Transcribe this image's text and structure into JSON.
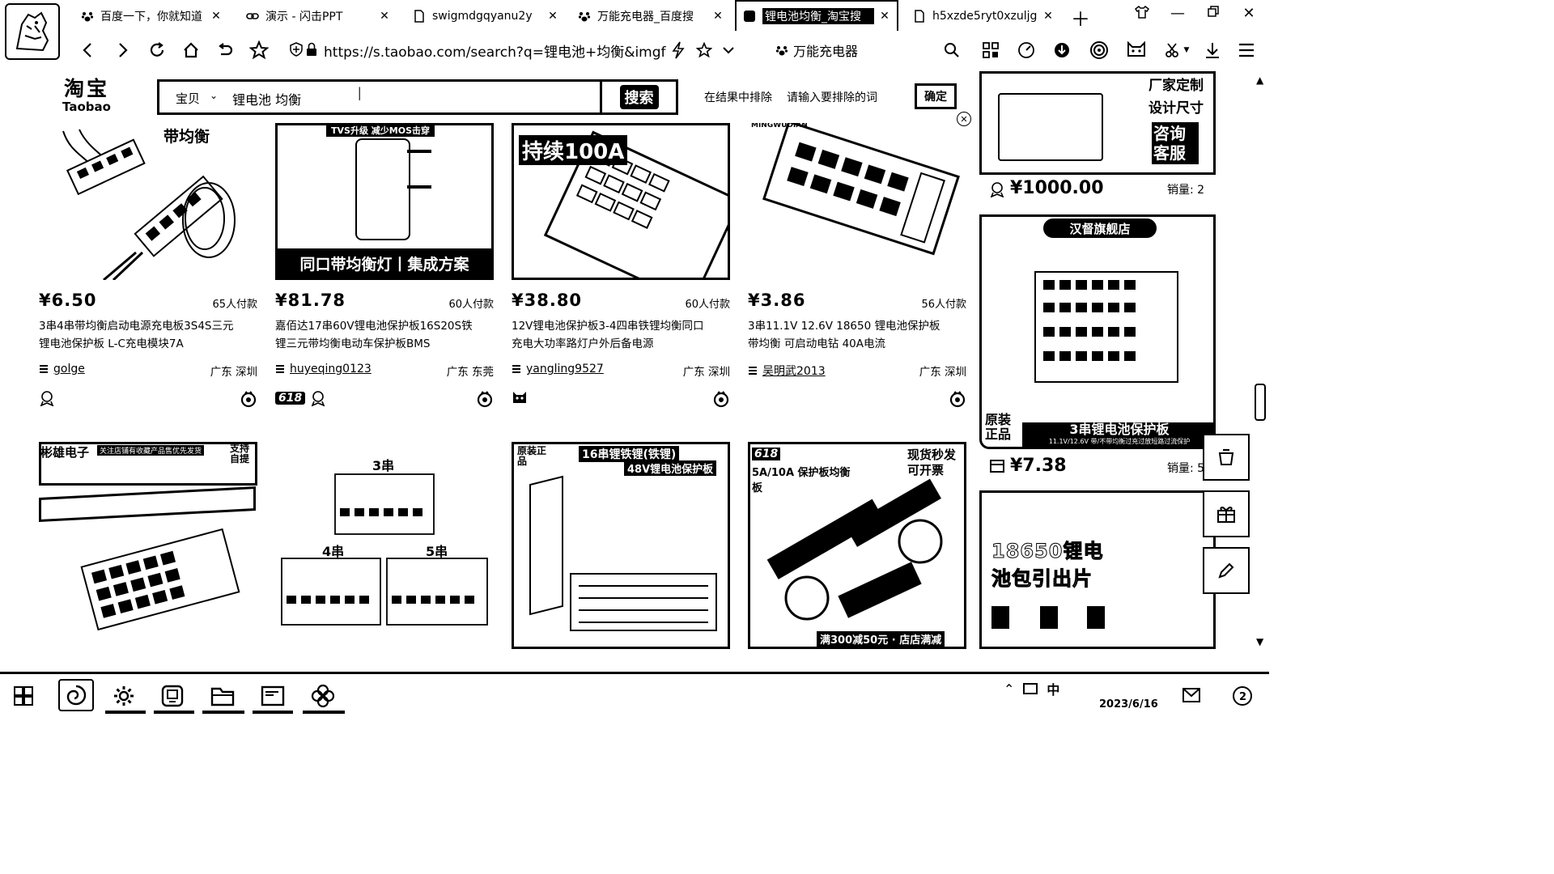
{
  "browser": {
    "tabs": [
      {
        "label": "百度一下，你就知道",
        "icon": "paw-icon"
      },
      {
        "label": "演示 - 闪击PPT",
        "icon": "link-icon"
      },
      {
        "label": "swigmdgqyanu2y",
        "icon": "doc-icon"
      },
      {
        "label": "万能充电器_百度搜",
        "icon": "paw-icon"
      },
      {
        "label": "锂电池均衡_淘宝搜",
        "icon": "taobao-icon",
        "active": true
      },
      {
        "label": "h5xzde5ryt0xzuljg",
        "icon": "doc-icon"
      }
    ],
    "url": "https://s.taobao.com/search?q=锂电池+均衡&imgf",
    "search_engine_query": "万能充电器"
  },
  "taobao": {
    "logo_cn": "淘宝",
    "logo_en": "Taobao",
    "search_category": "宝贝",
    "search_query": "锂电池 均衡",
    "search_button": "搜索",
    "exclude_label": "在结果中排除",
    "exclude_placeholder": "请输入要排除的词",
    "confirm_button": "确定"
  },
  "products": [
    {
      "price": "¥6.50",
      "paid": "65人付款",
      "title": "3串4串带均衡启动电源充电板3S4S三元锂电池保护板 L-C充电模块7A",
      "shop": "golge",
      "location": "广东 深圳",
      "img_text": "带均衡"
    },
    {
      "price": "¥81.78",
      "paid": "60人付款",
      "title": "嘉佰达17串60V锂电池保护板16S20S铁锂三元带均衡电动车保护板BMS",
      "shop": "huyeqing0123",
      "location": "广东 东莞",
      "img_text": "同口带均衡灯丨集成方案",
      "img_top": "TVS升级 减少MOS击穿",
      "badge": "618"
    },
    {
      "price": "¥38.80",
      "paid": "60人付款",
      "title": "12V锂电池保护板3-4四串铁锂均衡同口充电大功率路灯户外后备电源",
      "shop": "yangling9527",
      "location": "广东 深圳",
      "img_text": "持续100A"
    },
    {
      "price": "¥3.86",
      "paid": "56人付款",
      "title": "3串11.1V 12.6V 18650 锂电池保护板带均衡 可启动电钻 40A电流",
      "shop": "吴明武2013",
      "location": "广东 深圳",
      "img_text": "MINGWUDIAN"
    }
  ],
  "products_row2": [
    {
      "img_text": "彬雄电子",
      "img_sub": "关注店铺有收藏产品售优先发货",
      "img_tag": "支持自提"
    },
    {
      "img_text": "3串",
      "img_text2": "4串",
      "img_text3": "5串"
    },
    {
      "img_text": "16串锂铁锂(铁锂)",
      "img_sub": "48V锂电池保护板",
      "img_tag": "原装正品"
    },
    {
      "img_text": "现货秒发可开票",
      "img_sub": "5A/10A 保护板均衡板",
      "img_tag": "满300减50元 · 店店满减",
      "img_badge": "618"
    }
  ],
  "ads": [
    {
      "text1": "厂家定制",
      "text2": "设计尺寸",
      "text3": "咨询客服",
      "price": "¥1000.00",
      "sales": "销量: 2"
    },
    {
      "store": "汉督旗舰店",
      "tag": "原装正品",
      "banner": "3串锂电池保护板",
      "banner_sub": "11.1V/12.6V 带/不带均衡过充过放短路过流保护",
      "price": "¥7.38",
      "sales": "销量: 5"
    },
    {
      "text1": "18650锂电",
      "text2": "池包引出片"
    }
  ],
  "taskbar": {
    "date": "2023/6/16",
    "ime": "中"
  }
}
